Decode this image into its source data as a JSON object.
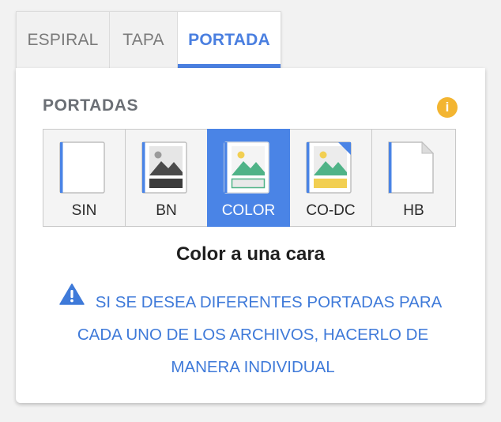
{
  "tabs": [
    {
      "label": "ESPIRAL",
      "active": false
    },
    {
      "label": "TAPA",
      "active": false
    },
    {
      "label": "PORTADA",
      "active": true
    }
  ],
  "section": {
    "title": "PORTADAS",
    "info_icon": "info-icon",
    "info_color": "#f3b531"
  },
  "options": [
    {
      "label": "SIN",
      "icon": "blank-page-icon",
      "selected": false
    },
    {
      "label": "BN",
      "icon": "bw-image-page-icon",
      "selected": false
    },
    {
      "label": "COLOR",
      "icon": "color-image-page-icon",
      "selected": true
    },
    {
      "label": "CO-DC",
      "icon": "color-double-page-icon",
      "selected": false
    },
    {
      "label": "HB",
      "icon": "folded-corner-page-icon",
      "selected": false
    }
  ],
  "caption": "Color a una cara",
  "warning": {
    "icon": "warning-triangle-icon",
    "text": "SI SE DESEA DIFERENTES PORTADAS PARA CADA UNO DE LOS ARCHIVOS, HACERLO DE MANERA INDIVIDUAL"
  },
  "colors": {
    "accent": "#4a84e6",
    "tab_active": "#4a7fe0",
    "warning_text": "#3f7ad9",
    "info": "#f3b531"
  }
}
